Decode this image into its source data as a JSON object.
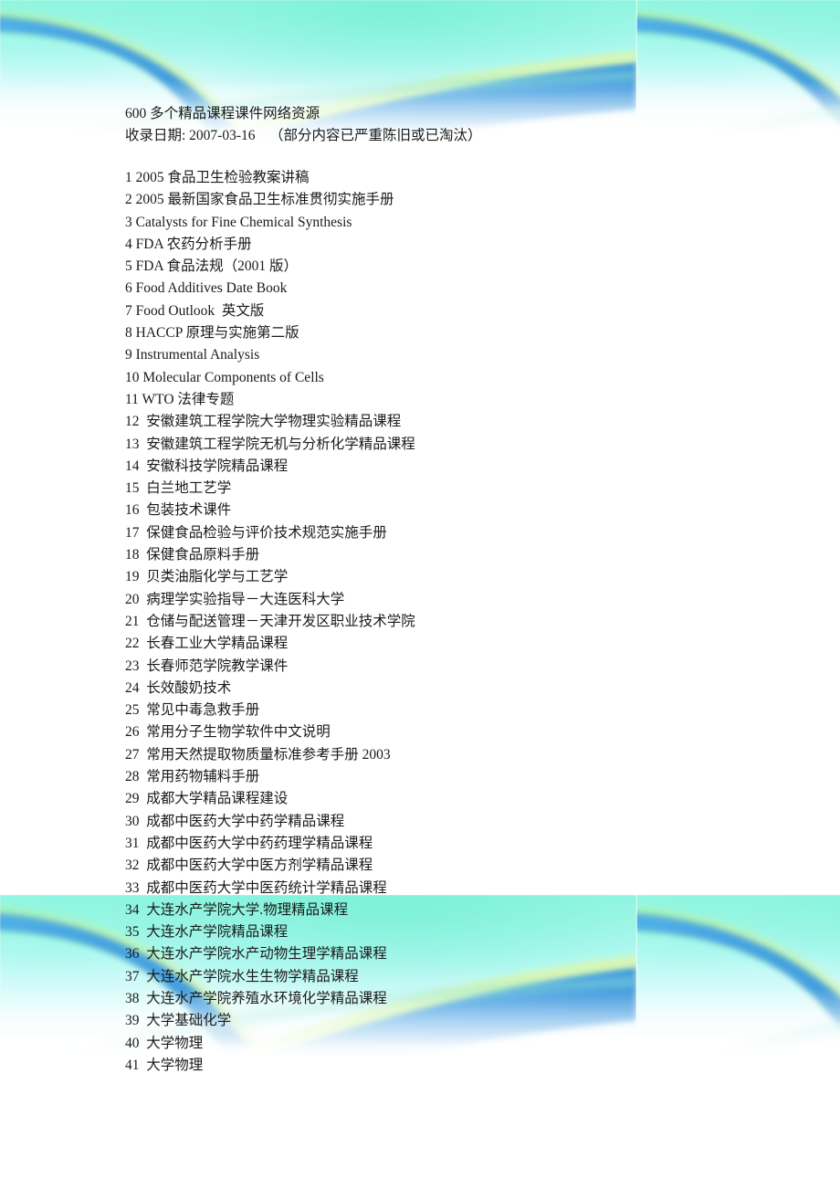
{
  "document": {
    "title": "600 多个精品课程课件网络资源",
    "date_line": "收录日期: 2007-03-16    （部分内容已严重陈旧或已淘汰）",
    "text_color": "#1a1a1a"
  },
  "decoration": {
    "style_name": "cyan-green-blue-ribbon-banner",
    "colors": {
      "cyan": "#96f7e4",
      "light_cyan": "#bafaf5",
      "green": "#90ee90",
      "yellow_green": "#c8f29a",
      "blue": "#46a8e8",
      "deep_blue": "#3a9ade",
      "white": "#ffffff"
    }
  },
  "list": {
    "items": [
      "1 2005 食品卫生检验教案讲稿",
      "2 2005 最新国家食品卫生标准贯彻实施手册",
      "3 Catalysts for Fine Chemical Synthesis",
      "4 FDA 农药分析手册",
      "5 FDA 食品法规（2001 版）",
      "6 Food Additives Date Book",
      "7 Food Outlook  英文版",
      "8 HACCP 原理与实施第二版",
      "9 Instrumental Analysis",
      "10 Molecular Components of Cells",
      "11 WTO 法律专题",
      "12  安徽建筑工程学院大学物理实验精品课程",
      "13  安徽建筑工程学院无机与分析化学精品课程",
      "14  安徽科技学院精品课程",
      "15  白兰地工艺学",
      "16  包装技术课件",
      "17  保健食品检验与评价技术规范实施手册",
      "18  保健食品原料手册",
      "19  贝类油脂化学与工艺学",
      "20  病理学实验指导－大连医科大学",
      "21  仓储与配送管理－天津开发区职业技术学院",
      "22  长春工业大学精品课程",
      "23  长春师范学院教学课件",
      "24  长效酸奶技术",
      "25  常见中毒急救手册",
      "26  常用分子生物学软件中文说明",
      "27  常用天然提取物质量标准参考手册 2003",
      "28  常用药物辅料手册",
      "29  成都大学精品课程建设",
      "30  成都中医药大学中药学精品课程",
      "31  成都中医药大学中药药理学精品课程",
      "32  成都中医药大学中医方剂学精品课程",
      "33  成都中医药大学中医药统计学精品课程",
      "34  大连水产学院大学.物理精品课程",
      "35  大连水产学院精品课程",
      "36  大连水产学院水产动物生理学精品课程",
      "37  大连水产学院水生生物学精品课程",
      "38  大连水产学院养殖水环境化学精品课程",
      "39  大学基础化学",
      "40  大学物理",
      "41  大学物理"
    ]
  }
}
